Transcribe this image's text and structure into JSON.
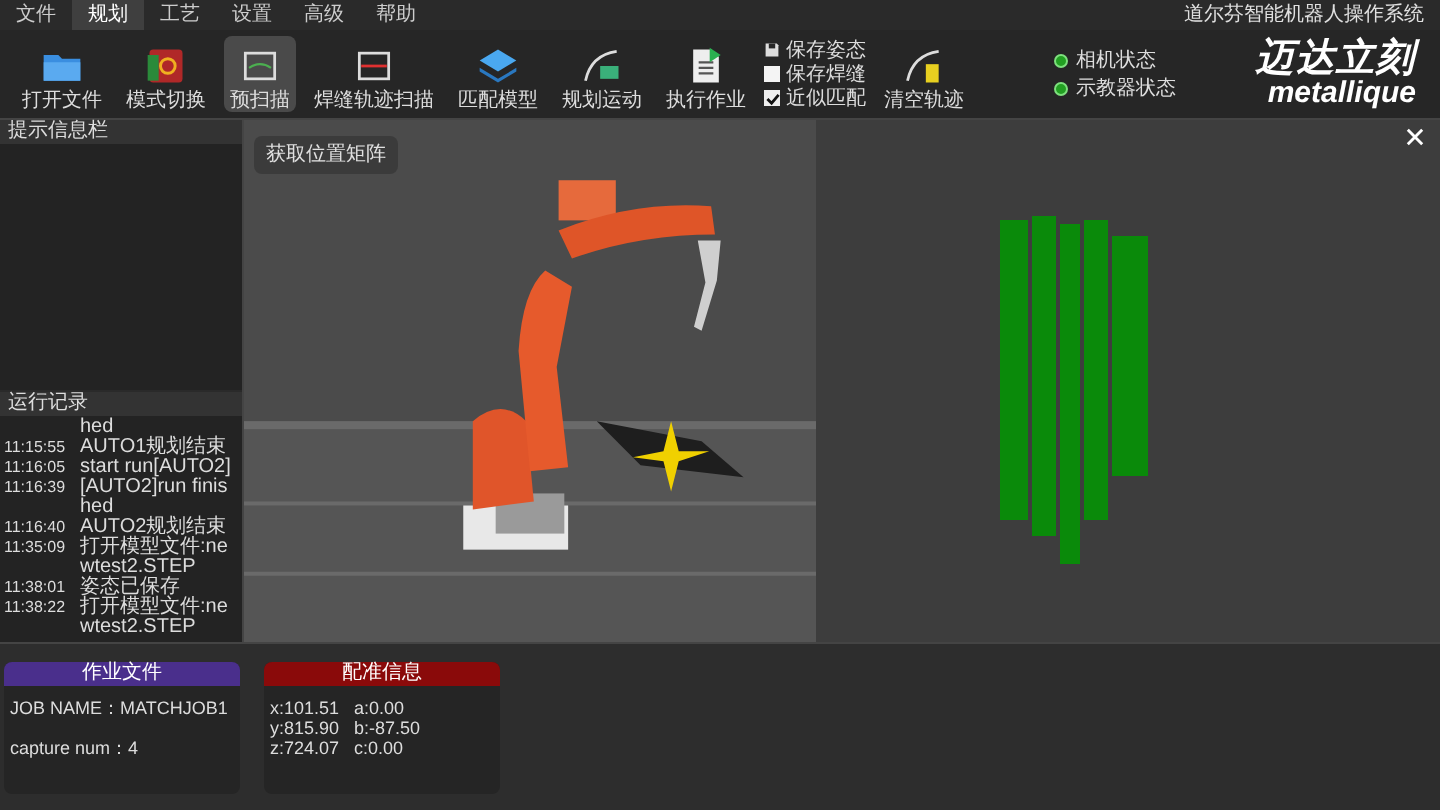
{
  "menu": [
    {
      "label": "文件",
      "selected": false
    },
    {
      "label": "规划",
      "selected": true
    },
    {
      "label": "工艺",
      "selected": false
    },
    {
      "label": "设置",
      "selected": false
    },
    {
      "label": "高级",
      "selected": false
    },
    {
      "label": "帮助",
      "selected": false
    }
  ],
  "app_title": "道尔芬智能机器人操作系统",
  "toolbar": {
    "tools": [
      {
        "label": "打开文件",
        "selected": false
      },
      {
        "label": "模式切换",
        "selected": false
      },
      {
        "label": "预扫描",
        "selected": true
      },
      {
        "label": "焊缝轨迹扫描",
        "selected": false
      },
      {
        "label": "匹配模型",
        "selected": false
      },
      {
        "label": "规划运动",
        "selected": false
      },
      {
        "label": "执行作业",
        "selected": false
      }
    ],
    "options": [
      {
        "kind": "button",
        "label": "保存姿态"
      },
      {
        "kind": "checkbox",
        "label": "保存焊缝",
        "checked": false
      },
      {
        "kind": "checkbox",
        "label": "近似匹配",
        "checked": true
      }
    ],
    "end_tool": {
      "label": "清空轨迹"
    }
  },
  "status": [
    {
      "label": "相机状态",
      "color": "#22a022"
    },
    {
      "label": "示教器状态",
      "color": "#22a022"
    }
  ],
  "logo": {
    "title": "迈达立刻",
    "subtitle": "metallique"
  },
  "info_panel": {
    "title": "提示信息栏"
  },
  "log_panel": {
    "title": "运行记录",
    "entries": [
      {
        "text": "hed"
      },
      {
        "time": "11:15:55",
        "text": "AUTO1规划结束"
      },
      {
        "time": "11:16:05",
        "text": "start run[AUTO2]"
      },
      {
        "time": "11:16:39",
        "text": "[AUTO2]run finished"
      },
      {
        "time": "11:16:40",
        "text": "AUTO2规划结束"
      },
      {
        "time": "11:35:09",
        "text": "打开模型文件:newtest2.STEP"
      },
      {
        "time": "11:38:01",
        "text": "姿态已保存"
      },
      {
        "time": "11:38:22",
        "text": "打开模型文件:newtest2.STEP"
      }
    ]
  },
  "viewport": {
    "button": "获取位置矩阵"
  },
  "cards": [
    {
      "title": "作业文件",
      "color": "#4a2f8c",
      "lines": [
        "JOB NAME：MATCHJOB1",
        "capture num：4"
      ]
    },
    {
      "title": "配准信息",
      "color": "#8a0a0a",
      "lines": [
        "x:101.51   a:0.00",
        "y:815.90   b:-87.50",
        "z:724.07   c:0.00"
      ]
    }
  ]
}
